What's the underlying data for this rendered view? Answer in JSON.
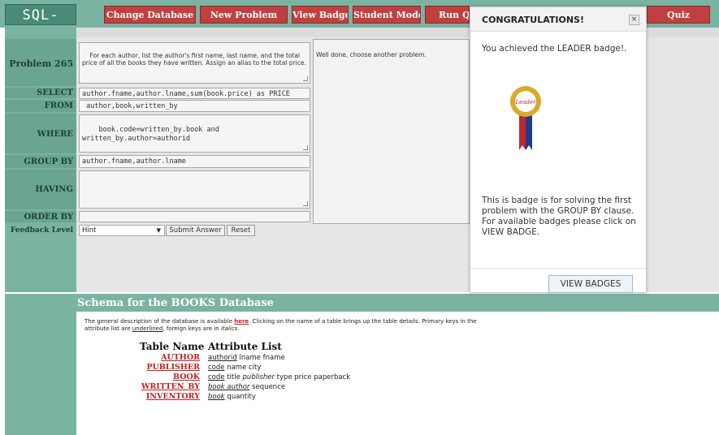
{
  "app": {
    "logo": "SQL-TUTOR"
  },
  "nav": {
    "change_database": "Change Database",
    "new_problem": "New Problem",
    "view_badges": "View Badges",
    "student_model": "Student Model",
    "run_query": "Run Q",
    "quiz": "Quiz"
  },
  "problem": {
    "label": "Problem 265",
    "text": "For each author, list the author's first name, last name, and the total price of all the books they have written. Assign an alias to the total price."
  },
  "clauses": {
    "select_label": "SELECT",
    "select_value": "author.fname,author.lname,sum(book.price) as PRICE",
    "from_label": "FROM",
    "from_value": " author,book,written_by",
    "where_label": "WHERE",
    "where_value": "book.code=written_by.book and\nwritten_by.author=authorid",
    "groupby_label": "GROUP BY",
    "groupby_value": "author.fname,author.lname",
    "having_label": "HAVING",
    "having_value": "",
    "orderby_label": "ORDER BY",
    "orderby_value": ""
  },
  "feedback": {
    "message": "Well done, choose another problem.",
    "level_label": "Feedback Level",
    "level_value": "Hint",
    "submit": "Submit Answer",
    "reset": "Reset"
  },
  "schema": {
    "title": "Schema for the BOOKS Database",
    "desc_part1": "The general description of the database is available ",
    "desc_link": "here",
    "desc_part2": ". Clicking on the name of a table brings up the table details. Primary keys in the attribute list are ",
    "desc_underlined": "underlined",
    "desc_part3": ", foreign keys are in ",
    "desc_italics": "italics",
    "desc_part4": ".",
    "col_table": "Table Name",
    "col_attrs": "Attribute List",
    "tables": [
      {
        "name": "AUTHOR",
        "pk": "authorid",
        "fk": "",
        "rest": " lname fname"
      },
      {
        "name": "PUBLISHER",
        "pk": "code",
        "fk": "",
        "rest": " name city"
      },
      {
        "name": "BOOK",
        "pk": "code",
        "fk": "",
        "rest": " title ",
        "fk_mid": "publisher",
        "rest2": " type price paperback"
      },
      {
        "name": "WRITTEN_BY",
        "pk": "",
        "fk": "book author",
        "rest": " sequence"
      },
      {
        "name": "INVENTORY",
        "pk": "",
        "fk": "book",
        "rest": " quantity"
      }
    ]
  },
  "modal": {
    "title": "CONGRATULATIONS!",
    "close": "×",
    "message": "You achieved the LEADER badge!.",
    "badge_text": "Leader",
    "description": "This is badge is for solving the first problem with the GROUP BY clause. For available badges please click on VIEW BADGE.",
    "button": "VIEW BADGES"
  },
  "colors": {
    "accent_green": "#7bb3a3",
    "nav_red": "#c04040",
    "badge_gold": "#d9a92a",
    "ribbon_red": "#c0262d",
    "ribbon_blue": "#1f3a8a"
  }
}
